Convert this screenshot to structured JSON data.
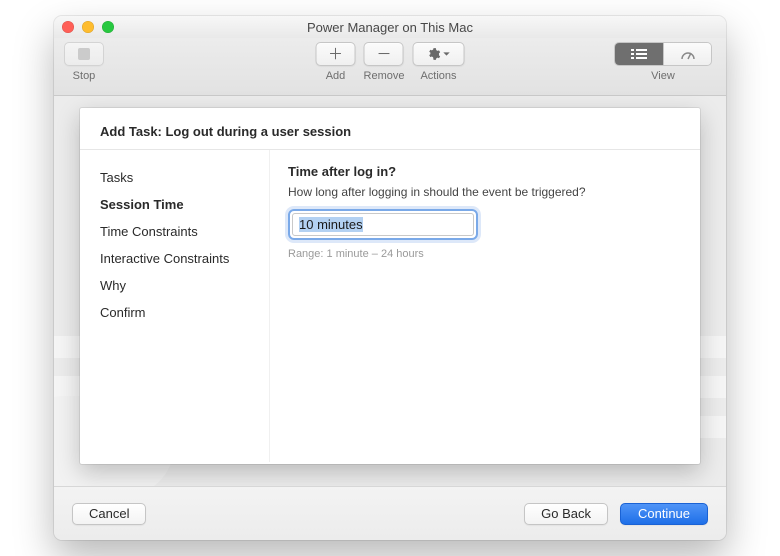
{
  "window": {
    "title": "Power Manager on This Mac"
  },
  "toolbar": {
    "stop_label": "Stop",
    "add_label": "Add",
    "remove_label": "Remove",
    "actions_label": "Actions",
    "view_label": "View"
  },
  "sheet": {
    "header": "Add Task: Log out during a user session"
  },
  "sidebar": {
    "steps": [
      {
        "label": "Tasks"
      },
      {
        "label": "Session Time"
      },
      {
        "label": "Time Constraints"
      },
      {
        "label": "Interactive Constraints"
      },
      {
        "label": "Why"
      },
      {
        "label": "Confirm"
      }
    ],
    "active_index": 1
  },
  "form": {
    "heading": "Time after log in?",
    "subtext": "How long after logging in should the event be triggered?",
    "value": "10 minutes",
    "range_hint": "Range: 1 minute – 24 hours"
  },
  "footer": {
    "cancel_label": "Cancel",
    "back_label": "Go Back",
    "continue_label": "Continue"
  }
}
